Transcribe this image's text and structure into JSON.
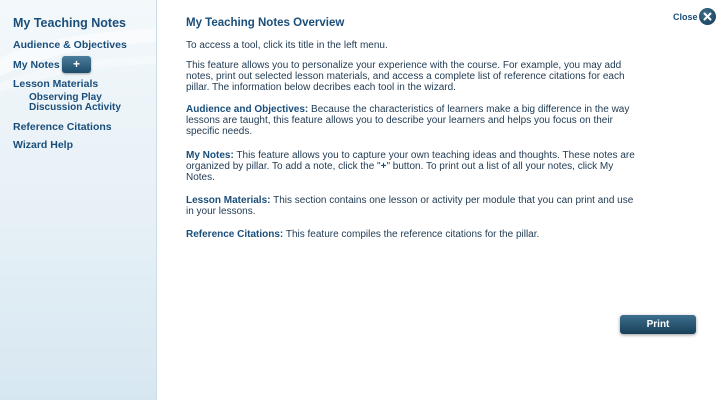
{
  "sidebar": {
    "title": "My Teaching Notes",
    "items": {
      "audience": "Audience & Objectives",
      "my_notes": "My Notes",
      "add_note": "+",
      "lesson_materials": "Lesson Materials",
      "lesson_sub": "Observing Play Discussion Activity",
      "reference": "Reference Citations",
      "wizard_help": "Wizard Help"
    }
  },
  "main": {
    "title": "My Teaching Notes Overview",
    "intro": "To access a tool, click its title in the left menu.",
    "feature": "This feature allows you to personalize your experience with the course. For example, you may add notes, print out selected lesson materials, and access a complete list of reference citations for each pillar. The information below decribes each tool in the wizard.",
    "sections": [
      {
        "heading": "Audience and Objectives:",
        "text": " Because the characteristics of learners make a big difference in the way lessons are taught, this feature allows you to describe your learners and helps you focus on their specific needs."
      },
      {
        "heading": "My Notes:",
        "text_a": " This feature allows you to capture your own teaching ideas and thoughts. These notes are organized by pillar. To add a note, click the \"",
        "plus": "+",
        "text_b": "\" button. To print out a list of all your notes, click My Notes."
      },
      {
        "heading": "Lesson Materials:",
        "text": " This section contains one lesson or activity per module that you can print and use in your lessons."
      },
      {
        "heading": "Reference Citations:",
        "text": " This feature compiles the reference citations for the pillar."
      }
    ]
  },
  "controls": {
    "close_label": "Close",
    "print_label": "Print"
  },
  "icons": {
    "close": "close-circle-x-icon",
    "add": "plus-icon"
  },
  "colors": {
    "heading": "#1a4e7a",
    "body_text": "#1f3a52",
    "button": "#1d4c69",
    "sidebar_bg": "#e6f0f6"
  }
}
